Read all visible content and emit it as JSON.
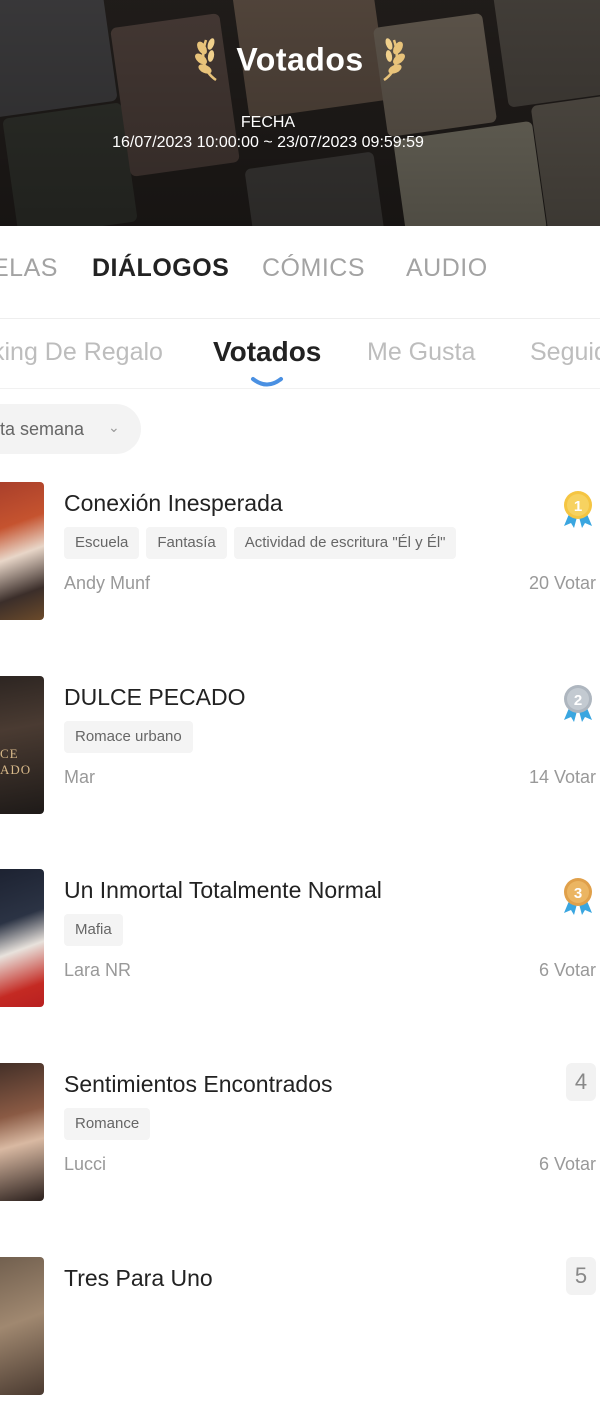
{
  "header": {
    "title": "Votados",
    "date_label": "FECHA",
    "date_range": "16/07/2023 10:00:00 ~ 23/07/2023 09:59:59"
  },
  "tabs": [
    {
      "label": "ELAS",
      "active": false
    },
    {
      "label": "DIÁLOGOS",
      "active": true
    },
    {
      "label": "CÓMICS",
      "active": false
    },
    {
      "label": "AUDIO",
      "active": false
    }
  ],
  "subtabs": [
    {
      "label": "king De Regalo",
      "active": false
    },
    {
      "label": "Votados",
      "active": true
    },
    {
      "label": "Me Gusta",
      "active": false
    },
    {
      "label": "Seguid",
      "active": false
    }
  ],
  "filter": {
    "label": "ta semana",
    "icon": "chevron-down-icon"
  },
  "list": [
    {
      "title": "Conexión Inesperada",
      "tags": [
        "Escuela",
        "Fantasía",
        "Actividad de escritura \"Él y Él\""
      ],
      "author": "Andy Munf",
      "votes": "20 Votar",
      "rank": "1",
      "medal": "gold"
    },
    {
      "title": "DULCE PECADO",
      "tags": [
        "Romace urbano"
      ],
      "author": "Mar",
      "votes": "14 Votar",
      "rank": "2",
      "medal": "silver",
      "cover_text": "CE ADO"
    },
    {
      "title": "Un Inmortal Totalmente Normal",
      "tags": [
        "Mafia"
      ],
      "author": "Lara NR",
      "votes": "6 Votar",
      "rank": "3",
      "medal": "bronze"
    },
    {
      "title": "Sentimientos Encontrados",
      "tags": [
        "Romance"
      ],
      "author": "Lucci",
      "votes": "6 Votar",
      "rank": "4",
      "medal": null
    },
    {
      "title": "Tres Para Uno",
      "tags": [],
      "author": "",
      "votes": "",
      "rank": "5",
      "medal": null
    }
  ],
  "colors": {
    "accent": "#4a90e2",
    "gold": "#f5c542",
    "silver": "#aeb6bf",
    "bronze": "#e0a04a",
    "ribbon": "#3aa6e0"
  }
}
